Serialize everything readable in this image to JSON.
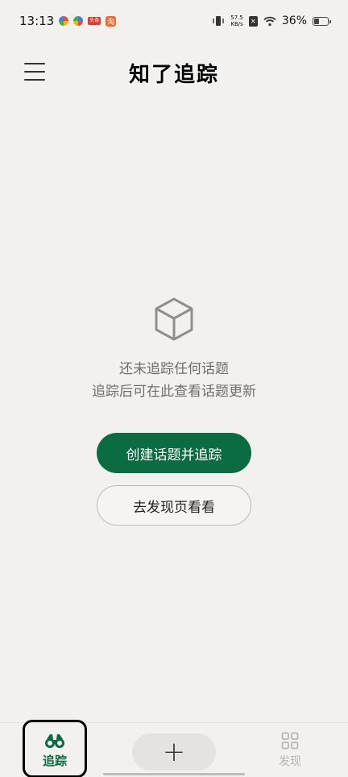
{
  "status_bar": {
    "time": "13:13",
    "net_speed_value": "57.5",
    "net_speed_unit": "KB/s",
    "battery": "36%",
    "battery_fraction": 0.36,
    "app_badge_text": "头条",
    "app_square_text": "淘"
  },
  "header": {
    "title": "知了追踪"
  },
  "empty_state": {
    "line1": "还未追踪任何话题",
    "line2": "追踪后可在此查看话题更新",
    "primary_button": "创建话题并追踪",
    "secondary_button": "去发现页看看"
  },
  "bottom_nav": {
    "track_label": "追踪",
    "add_label": "+",
    "discover_label": "发现"
  },
  "colors": {
    "accent": "#0b6b41",
    "background": "#f2f1ef",
    "muted_text": "#6e6e6e"
  }
}
